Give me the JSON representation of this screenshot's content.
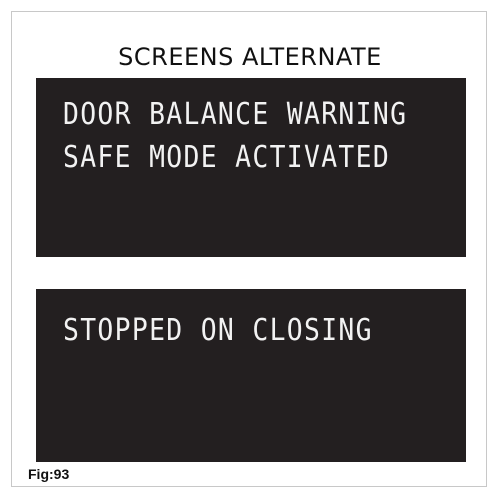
{
  "heading": "SCREENS ALTERNATE",
  "screens": [
    {
      "lines": [
        "DOOR BALANCE WARNING",
        "SAFE MODE ACTIVATED"
      ]
    },
    {
      "lines": [
        "STOPPED ON CLOSING"
      ]
    }
  ],
  "figure_label": "Fig:93",
  "colors": {
    "screen_background": "#231f20",
    "screen_text": "#f2f2f2"
  }
}
